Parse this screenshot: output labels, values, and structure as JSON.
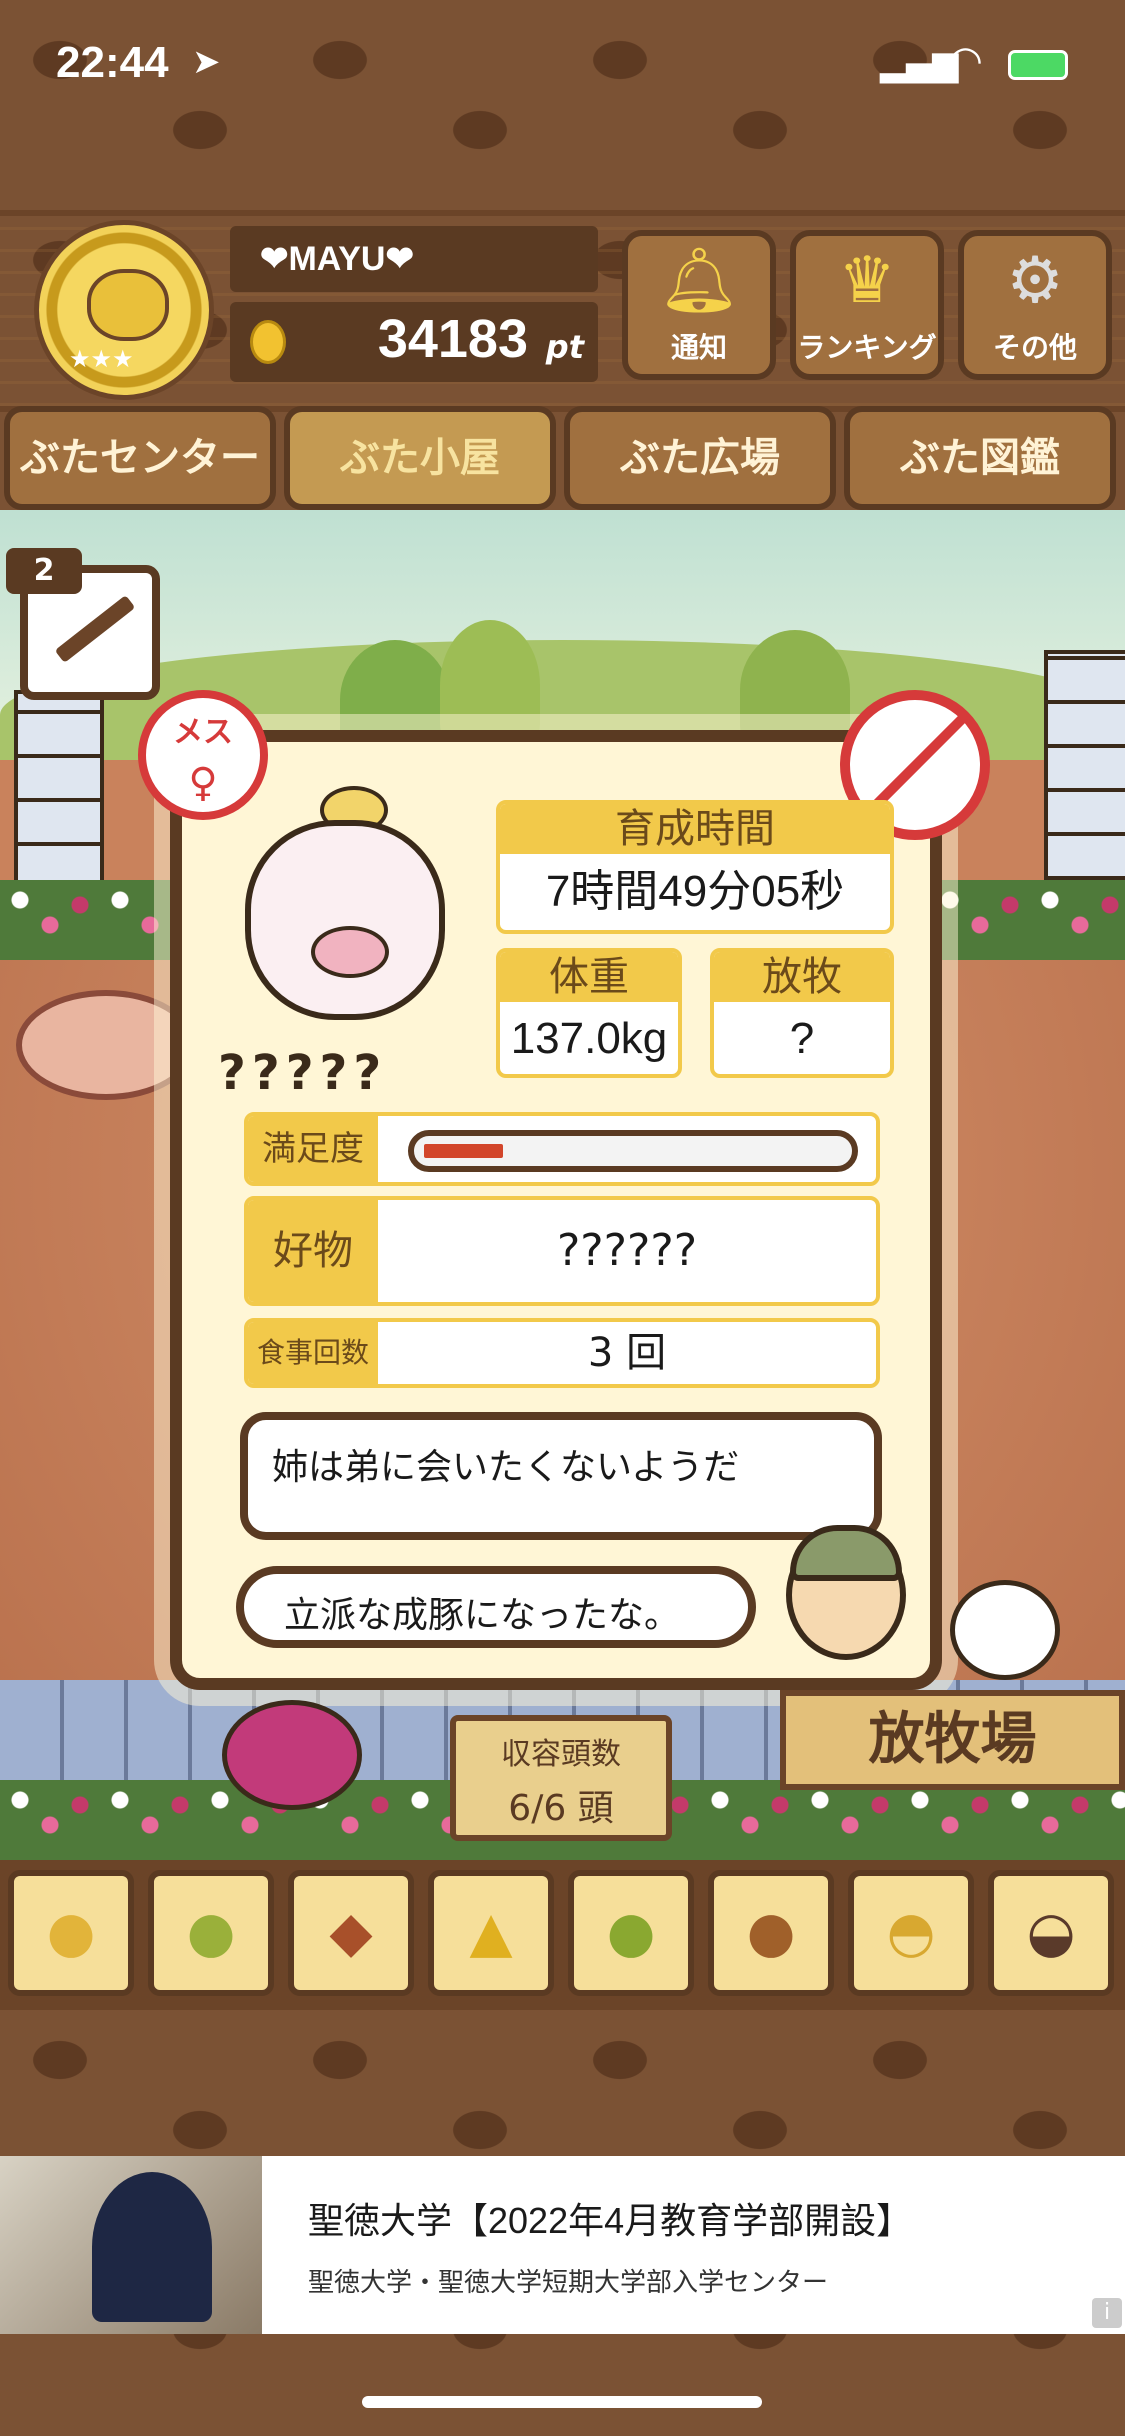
{
  "status_bar": {
    "time": "22:44"
  },
  "header": {
    "player_name": "❤MAYU❤",
    "points": "34183",
    "points_unit": "pt",
    "buttons": [
      {
        "label": "通知",
        "icon": "bell-icon"
      },
      {
        "label": "ランキング",
        "icon": "crown-icon"
      },
      {
        "label": "その他",
        "icon": "gear-icon"
      }
    ]
  },
  "tabs": [
    {
      "label": "ぶたセンター"
    },
    {
      "label": "ぶた小屋",
      "active": true
    },
    {
      "label": "ぶた広場"
    },
    {
      "label": "ぶた図鑑"
    }
  ],
  "syringe_count": "2",
  "pig": {
    "gender_label": "メス",
    "name": "?????",
    "growth_time_label": "育成時間",
    "growth_time": "7時間49分05秒",
    "weight_label": "体重",
    "weight": "137.0kg",
    "grazing_label": "放牧",
    "grazing": "?",
    "satisfaction_label": "満足度",
    "satisfaction_level": 0.18,
    "favorite_label": "好物",
    "favorite": "??????",
    "meals_label": "食事回数",
    "meals": "3 回",
    "message": "姉は弟に会いたくないようだ",
    "farmer_comment": "立派な成豚になったな。"
  },
  "capacity": {
    "label": "収容頭数",
    "value": "6/6 頭"
  },
  "grazing_sign": "放牧場",
  "foods": [
    {
      "icon": "soybean-icon",
      "glyph": "●"
    },
    {
      "icon": "green-bean-icon",
      "glyph": "●"
    },
    {
      "icon": "sweet-potato-icon",
      "glyph": "◆"
    },
    {
      "icon": "corn-icon",
      "glyph": "▲"
    },
    {
      "icon": "olive-icon",
      "glyph": "●"
    },
    {
      "icon": "acorn-icon",
      "glyph": "●"
    },
    {
      "icon": "grain-bowl-icon",
      "glyph": "◓"
    },
    {
      "icon": "truffle-plate-icon",
      "glyph": "◒"
    }
  ],
  "ad": {
    "title": "聖徳大学【2022年4月教育学部開設】",
    "subtitle": "聖徳大学・聖徳大学短期大学部入学センター",
    "info": "i"
  },
  "colors": {
    "wood_dark": "#5a3a22",
    "accent_yellow": "#f2c94a",
    "female_red": "#d63a3a",
    "satisfaction_fill": "#d2452a"
  }
}
